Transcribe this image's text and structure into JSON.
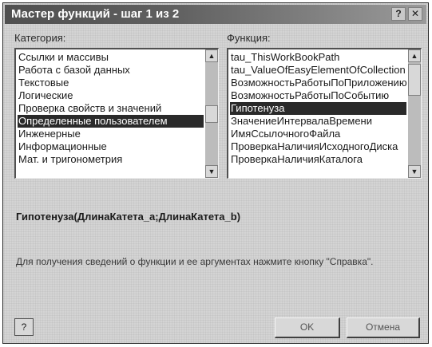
{
  "window": {
    "title": "Мастер функций - шаг 1 из 2",
    "help_glyph": "?",
    "close_glyph": "✕"
  },
  "category": {
    "label": "Категория:",
    "items": [
      {
        "label": "Ссылки и массивы",
        "selected": false
      },
      {
        "label": "Работа с базой данных",
        "selected": false
      },
      {
        "label": "Текстовые",
        "selected": false
      },
      {
        "label": "Логические",
        "selected": false
      },
      {
        "label": "Проверка свойств и значений",
        "selected": false
      },
      {
        "label": "Определенные пользователем",
        "selected": true
      },
      {
        "label": "Инженерные",
        "selected": false
      },
      {
        "label": "Информационные",
        "selected": false
      },
      {
        "label": "Мат. и тригонометрия",
        "selected": false
      }
    ]
  },
  "function": {
    "label": "Функция:",
    "items": [
      {
        "label": "tau_ThisWorkBookPath",
        "selected": false
      },
      {
        "label": "tau_ValueOfEasyElementOfCollection",
        "selected": false
      },
      {
        "label": "ВозможностьРаботыПоПриложению",
        "selected": false
      },
      {
        "label": "ВозможностьРаботыПоСобытию",
        "selected": false
      },
      {
        "label": "Гипотенуза",
        "selected": true
      },
      {
        "label": "ЗначениеИнтервалаВремени",
        "selected": false
      },
      {
        "label": "ИмяСсылочногоФайла",
        "selected": false
      },
      {
        "label": "ПроверкаНаличияИсходногоДиска",
        "selected": false
      },
      {
        "label": "ПроверкаНаличияКаталога",
        "selected": false
      }
    ]
  },
  "signature": "Гипотенуза(ДлинаКатета_a;ДлинаКатета_b)",
  "description": "Для получения сведений о функции и ее аргументах нажмите кнопку \"Справка\".",
  "buttons": {
    "help": "?",
    "ok": "OK",
    "cancel": "Отмена"
  },
  "icons": {
    "scroll_up": "▲",
    "scroll_down": "▼"
  }
}
